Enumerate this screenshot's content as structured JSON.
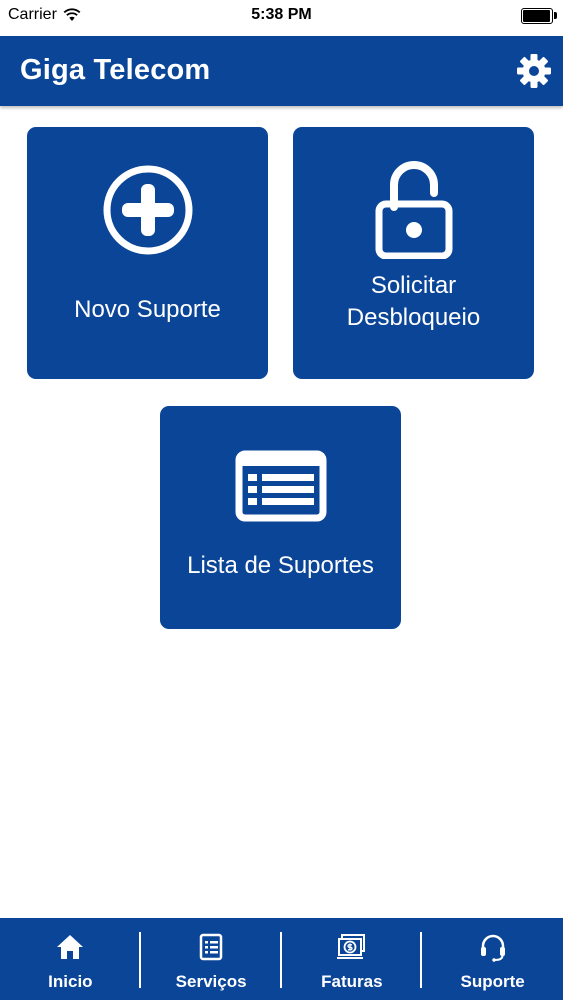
{
  "status_bar": {
    "carrier": "Carrier",
    "time": "5:38 PM",
    "battery_level": 0.95
  },
  "header": {
    "title": "Giga Telecom"
  },
  "tiles": [
    {
      "label": "Novo Suporte",
      "icon": "plus-circle-icon"
    },
    {
      "label": "Solicitar Desbloqueio",
      "icon": "unlocked-padlock-icon"
    },
    {
      "label": "Lista de Suportes",
      "icon": "list-icon"
    }
  ],
  "tabs": [
    {
      "label": "Inicio",
      "icon": "home-icon"
    },
    {
      "label": "Serviços",
      "icon": "document-icon"
    },
    {
      "label": "Faturas",
      "icon": "money-icon"
    },
    {
      "label": "Suporte",
      "icon": "headset-icon"
    }
  ],
  "colors": {
    "primary": "#0a4598",
    "on_primary": "#ffffff",
    "background": "#ffffff"
  }
}
